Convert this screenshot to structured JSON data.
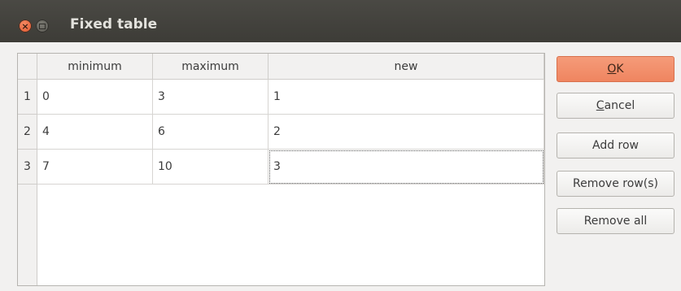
{
  "window": {
    "title": "Fixed table"
  },
  "table": {
    "columns": [
      "minimum",
      "maximum",
      "new"
    ],
    "rows": [
      {
        "header": "1",
        "cells": [
          "0",
          "3",
          "1"
        ]
      },
      {
        "header": "2",
        "cells": [
          "4",
          "6",
          "2"
        ]
      },
      {
        "header": "3",
        "cells": [
          "7",
          "10",
          "3"
        ]
      }
    ],
    "focused_cell": {
      "row": 3,
      "column": "new"
    }
  },
  "buttons": {
    "ok": {
      "mnemonic": "O",
      "rest": "K"
    },
    "cancel": {
      "mnemonic": "C",
      "rest": "ancel"
    },
    "add_row": "Add row",
    "remove_rows": "Remove row(s)",
    "remove_all": "Remove all"
  },
  "colors": {
    "primary_button": "#ef8560",
    "titlebar": "#3d3c37",
    "close_button": "#e0532a"
  },
  "icons": [
    "close-icon",
    "minimize-icon"
  ]
}
